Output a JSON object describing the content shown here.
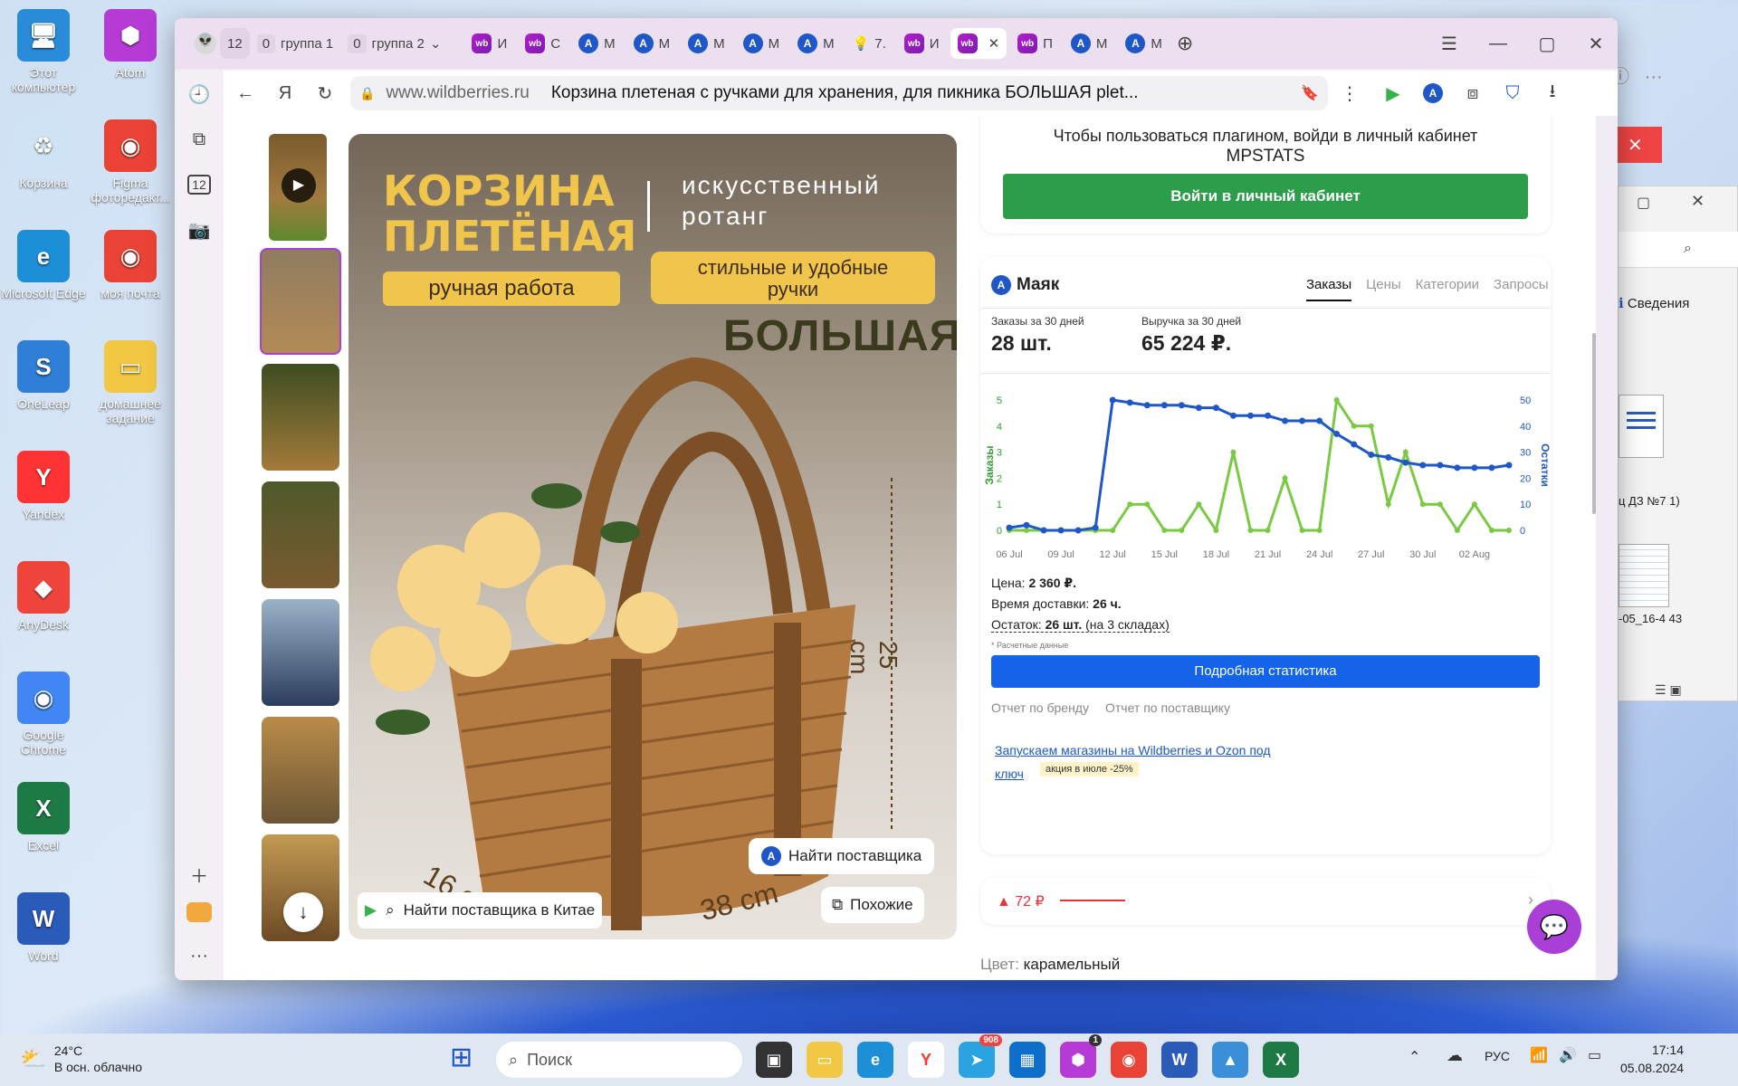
{
  "desktop": {
    "icons": [
      {
        "label": "Этот компьютер",
        "sym": "🖥",
        "bg": "#2a8bd8"
      },
      {
        "label": "Atom",
        "sym": "⬢",
        "bg": "#b53ad6"
      },
      {
        "label": "Корзина",
        "sym": "♻",
        "bg": "#cfe3f5"
      },
      {
        "label": "Figma фоторедакт...",
        "sym": "◉",
        "bg": "#ea4335"
      },
      {
        "label": "Microsoft Edge",
        "sym": "e",
        "bg": "#1d8fd6"
      },
      {
        "label": "моя почта",
        "sym": "◉",
        "bg": "#ea4335"
      },
      {
        "label": "OneLeap",
        "sym": "S",
        "bg": "#2f7fd9"
      },
      {
        "label": "домашнее задание",
        "sym": "▭",
        "bg": "#f2c744"
      },
      {
        "label": "Yandex",
        "sym": "Y",
        "bg": "#ff3333"
      },
      {
        "label": "AnyDesk",
        "sym": "◆",
        "bg": "#ef443b"
      },
      {
        "label": "Google Chrome",
        "sym": "◉",
        "bg": "#4285f4"
      },
      {
        "label": "Excel",
        "sym": "X",
        "bg": "#1d7a45"
      },
      {
        "label": "Word",
        "sym": "W",
        "bg": "#2b5bb8"
      }
    ]
  },
  "browser": {
    "tab_count": "12",
    "groups": [
      {
        "count": "0",
        "label": "группа 1"
      },
      {
        "count": "0",
        "label": "группа 2"
      }
    ],
    "tabs": [
      {
        "kind": "wb",
        "label": "И"
      },
      {
        "kind": "wb",
        "label": "С"
      },
      {
        "kind": "mp",
        "label": "М"
      },
      {
        "kind": "mp",
        "label": "М"
      },
      {
        "kind": "mp",
        "label": "М"
      },
      {
        "kind": "mp",
        "label": "М"
      },
      {
        "kind": "mp",
        "label": "М"
      },
      {
        "kind": "bulb",
        "label": "7."
      },
      {
        "kind": "wb",
        "label": "И"
      },
      {
        "kind": "wb",
        "label": "",
        "active": true
      },
      {
        "kind": "wb",
        "label": "П"
      },
      {
        "kind": "mp",
        "label": "М"
      },
      {
        "kind": "mp",
        "label": "М"
      }
    ],
    "domain": "www.wildberries.ru",
    "page_title": "Корзина плетеная с ручками для хранения, для пикника БОЛЬШАЯ plet...",
    "side_count": "12"
  },
  "product": {
    "banner_title_1": "КОРЗИНА",
    "banner_title_2": "ПЛЕТЁНАЯ",
    "banner_sub": "искусственный ротанг",
    "badge_1": "ручная работа",
    "badge_2": "стильные и удобные ручки",
    "big_label": "БОЛЬШАЯ",
    "dim_h": "25 cm",
    "dim_w": "38 cm",
    "dim_d": "16 cm",
    "find_supplier": "Найти поставщика",
    "find_china": "Найти поставщика в Китае",
    "similar": "Похожие"
  },
  "mpstats": {
    "login_text": "Чтобы пользоваться плагином, войди в личный кабинет",
    "brand": "MPSTATS",
    "login_button": "Войти в личный кабинет",
    "widget_name": "Маяк",
    "tabs": [
      "Заказы",
      "Цены",
      "Категории",
      "Запросы"
    ],
    "orders_label": "Заказы за 30 дней",
    "orders_value": "28 шт.",
    "revenue_label": "Выручка за 30 дней",
    "revenue_value": "65 224 ₽.",
    "price_label": "Цена:",
    "price_value": "2 360 ₽.",
    "delivery_label": "Время доставки:",
    "delivery_value": "26 ч.",
    "stock_label": "Остаток:",
    "stock_value": "26 шт.",
    "stock_note": "(на 3 складах)",
    "calc_note": "* Расчетные данные",
    "stats_button": "Подробная статистика",
    "brand_report": "Отчет по бренду",
    "supplier_report": "Отчет по поставщику",
    "promo_link": "Запускаем магазины на Wildberries и Ozon под ключ",
    "promo_badge": "акция в июле -25%",
    "price_change": "▲ 72 ₽",
    "color_label": "Цвет:",
    "color_value": "карамельный",
    "colors": {
      "green": "#7ac943",
      "blue": "#1f57c8",
      "accent": "#2c9d4a"
    }
  },
  "chart_data": {
    "type": "line",
    "x": [
      "06 Jul",
      "07 Jul",
      "08 Jul",
      "09 Jul",
      "10 Jul",
      "11 Jul",
      "12 Jul",
      "13 Jul",
      "14 Jul",
      "15 Jul",
      "16 Jul",
      "17 Jul",
      "18 Jul",
      "19 Jul",
      "20 Jul",
      "21 Jul",
      "22 Jul",
      "23 Jul",
      "24 Jul",
      "25 Jul",
      "26 Jul",
      "27 Jul",
      "28 Jul",
      "29 Jul",
      "30 Jul",
      "31 Jul",
      "01 Aug",
      "02 Aug",
      "03 Aug",
      "04 Aug"
    ],
    "xticks": [
      "06 Jul",
      "09 Jul",
      "12 Jul",
      "15 Jul",
      "18 Jul",
      "21 Jul",
      "24 Jul",
      "27 Jul",
      "30 Jul",
      "02 Aug"
    ],
    "series": [
      {
        "name": "Заказы",
        "axis": "left",
        "values": [
          0,
          0,
          0,
          0,
          0,
          0,
          0,
          1,
          1,
          0,
          0,
          1,
          0,
          3,
          0,
          0,
          2,
          0,
          0,
          5,
          4,
          4,
          1,
          3,
          1,
          1,
          0,
          1,
          0,
          0
        ]
      },
      {
        "name": "Остатки",
        "axis": "right",
        "values": [
          1,
          2,
          0,
          0,
          0,
          1,
          50,
          49,
          48,
          48,
          48,
          47,
          47,
          44,
          44,
          44,
          42,
          42,
          42,
          37,
          33,
          29,
          28,
          26,
          25,
          25,
          24,
          24,
          24,
          25
        ]
      }
    ],
    "ylabel": "Заказы",
    "y2label": "Остатки",
    "ylim": [
      0,
      5
    ],
    "y2lim": [
      0,
      50
    ],
    "yticks": [
      0,
      1,
      2,
      3,
      4,
      5
    ],
    "y2ticks": [
      0,
      10,
      20,
      30,
      40,
      50
    ]
  },
  "other_window": {
    "label": "Сведения",
    "file_1": "ц ДЗ №7 1)",
    "file_2": "-05_16-4 43"
  },
  "taskbar": {
    "weather_temp": "24°C",
    "weather_desc": "В осн. облачно",
    "search_placeholder": "Поиск",
    "lang": "РУС",
    "time": "17:14",
    "date": "05.08.2024",
    "telegram_badge": "908",
    "atom_badge": "1"
  }
}
